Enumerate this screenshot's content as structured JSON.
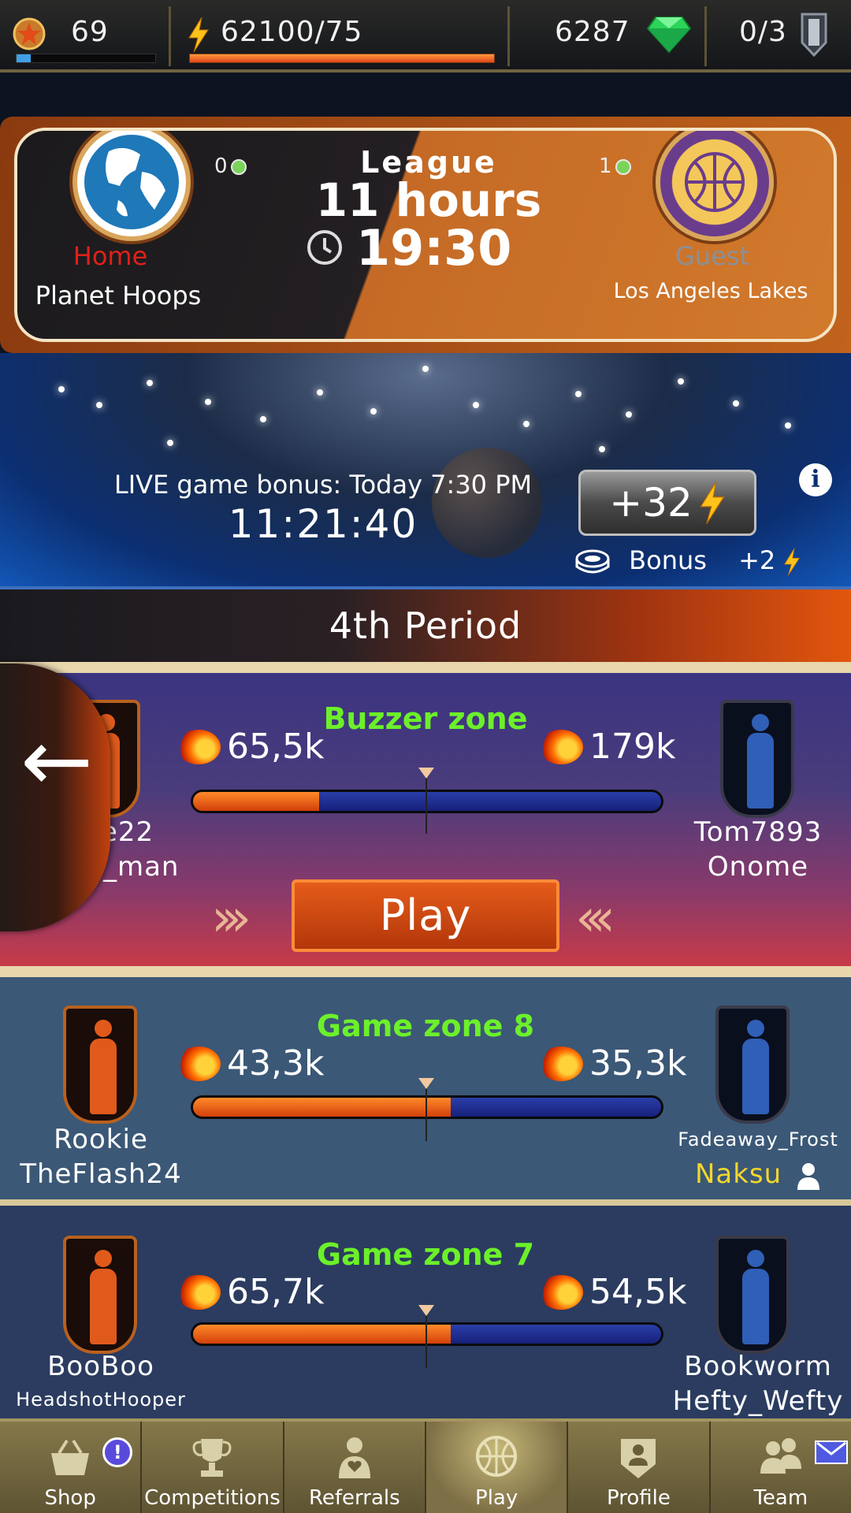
{
  "status_bar": {
    "level": "69",
    "energy": "62100/75",
    "gems": "6287",
    "tickets": "0/3",
    "xp_progress": 0.1,
    "energy_progress": 1.0
  },
  "match": {
    "competition": "League",
    "countdown": "11 hours",
    "time": "19:30",
    "home": {
      "role": "Home",
      "name": "Planet Hoops",
      "score": "0"
    },
    "guest": {
      "role": "Guest",
      "name": "Los Angeles Lakes",
      "score": "1",
      "logo_text": "LOS ANGELES LAKES"
    }
  },
  "live_bonus": {
    "title": "LIVE game bonus: Today 7:30 PM",
    "timer": "11:21:40",
    "bonus_value": "+32",
    "bonus_label": "Bonus",
    "bonus_extra": "+2"
  },
  "period": {
    "label": "4th Period"
  },
  "zones": [
    {
      "title": "Buzzer zone",
      "home_score": "65,5k",
      "guest_score": "179k",
      "home_share": 0.27,
      "home_players": [
        "babe22",
        "World_man"
      ],
      "guest_players": [
        "Tom7893",
        "Onome"
      ],
      "play_label": "Play"
    },
    {
      "title": "Game zone 8",
      "home_score": "43,3k",
      "guest_score": "35,3k",
      "home_share": 0.55,
      "home_players": [
        "Rookie",
        "TheFlash24"
      ],
      "guest_players": [
        "Fadeaway_Frost",
        "Naksu"
      ]
    },
    {
      "title": "Game zone 7",
      "home_score": "65,7k",
      "guest_score": "54,5k",
      "home_share": 0.55,
      "home_players": [
        "BooBoo",
        "HeadshotHooper"
      ],
      "guest_players": [
        "Bookworm",
        "Hefty_Wefty"
      ]
    }
  ],
  "nav": [
    {
      "label": "Shop",
      "icon": "basket-icon",
      "badge": "!"
    },
    {
      "label": "Competitions",
      "icon": "trophy-icon"
    },
    {
      "label": "Referrals",
      "icon": "person-heart-icon"
    },
    {
      "label": "Play",
      "icon": "basketball-icon",
      "active": true
    },
    {
      "label": "Profile",
      "icon": "badge-person-icon"
    },
    {
      "label": "Team",
      "icon": "team-icon"
    }
  ],
  "colors": {
    "accent_orange": "#e2560e",
    "zone_title_green": "#6cf02a",
    "home_role_red": "#e0201a",
    "guest_role_gray": "#9aa0a6",
    "me_yellow": "#f3d72b"
  }
}
